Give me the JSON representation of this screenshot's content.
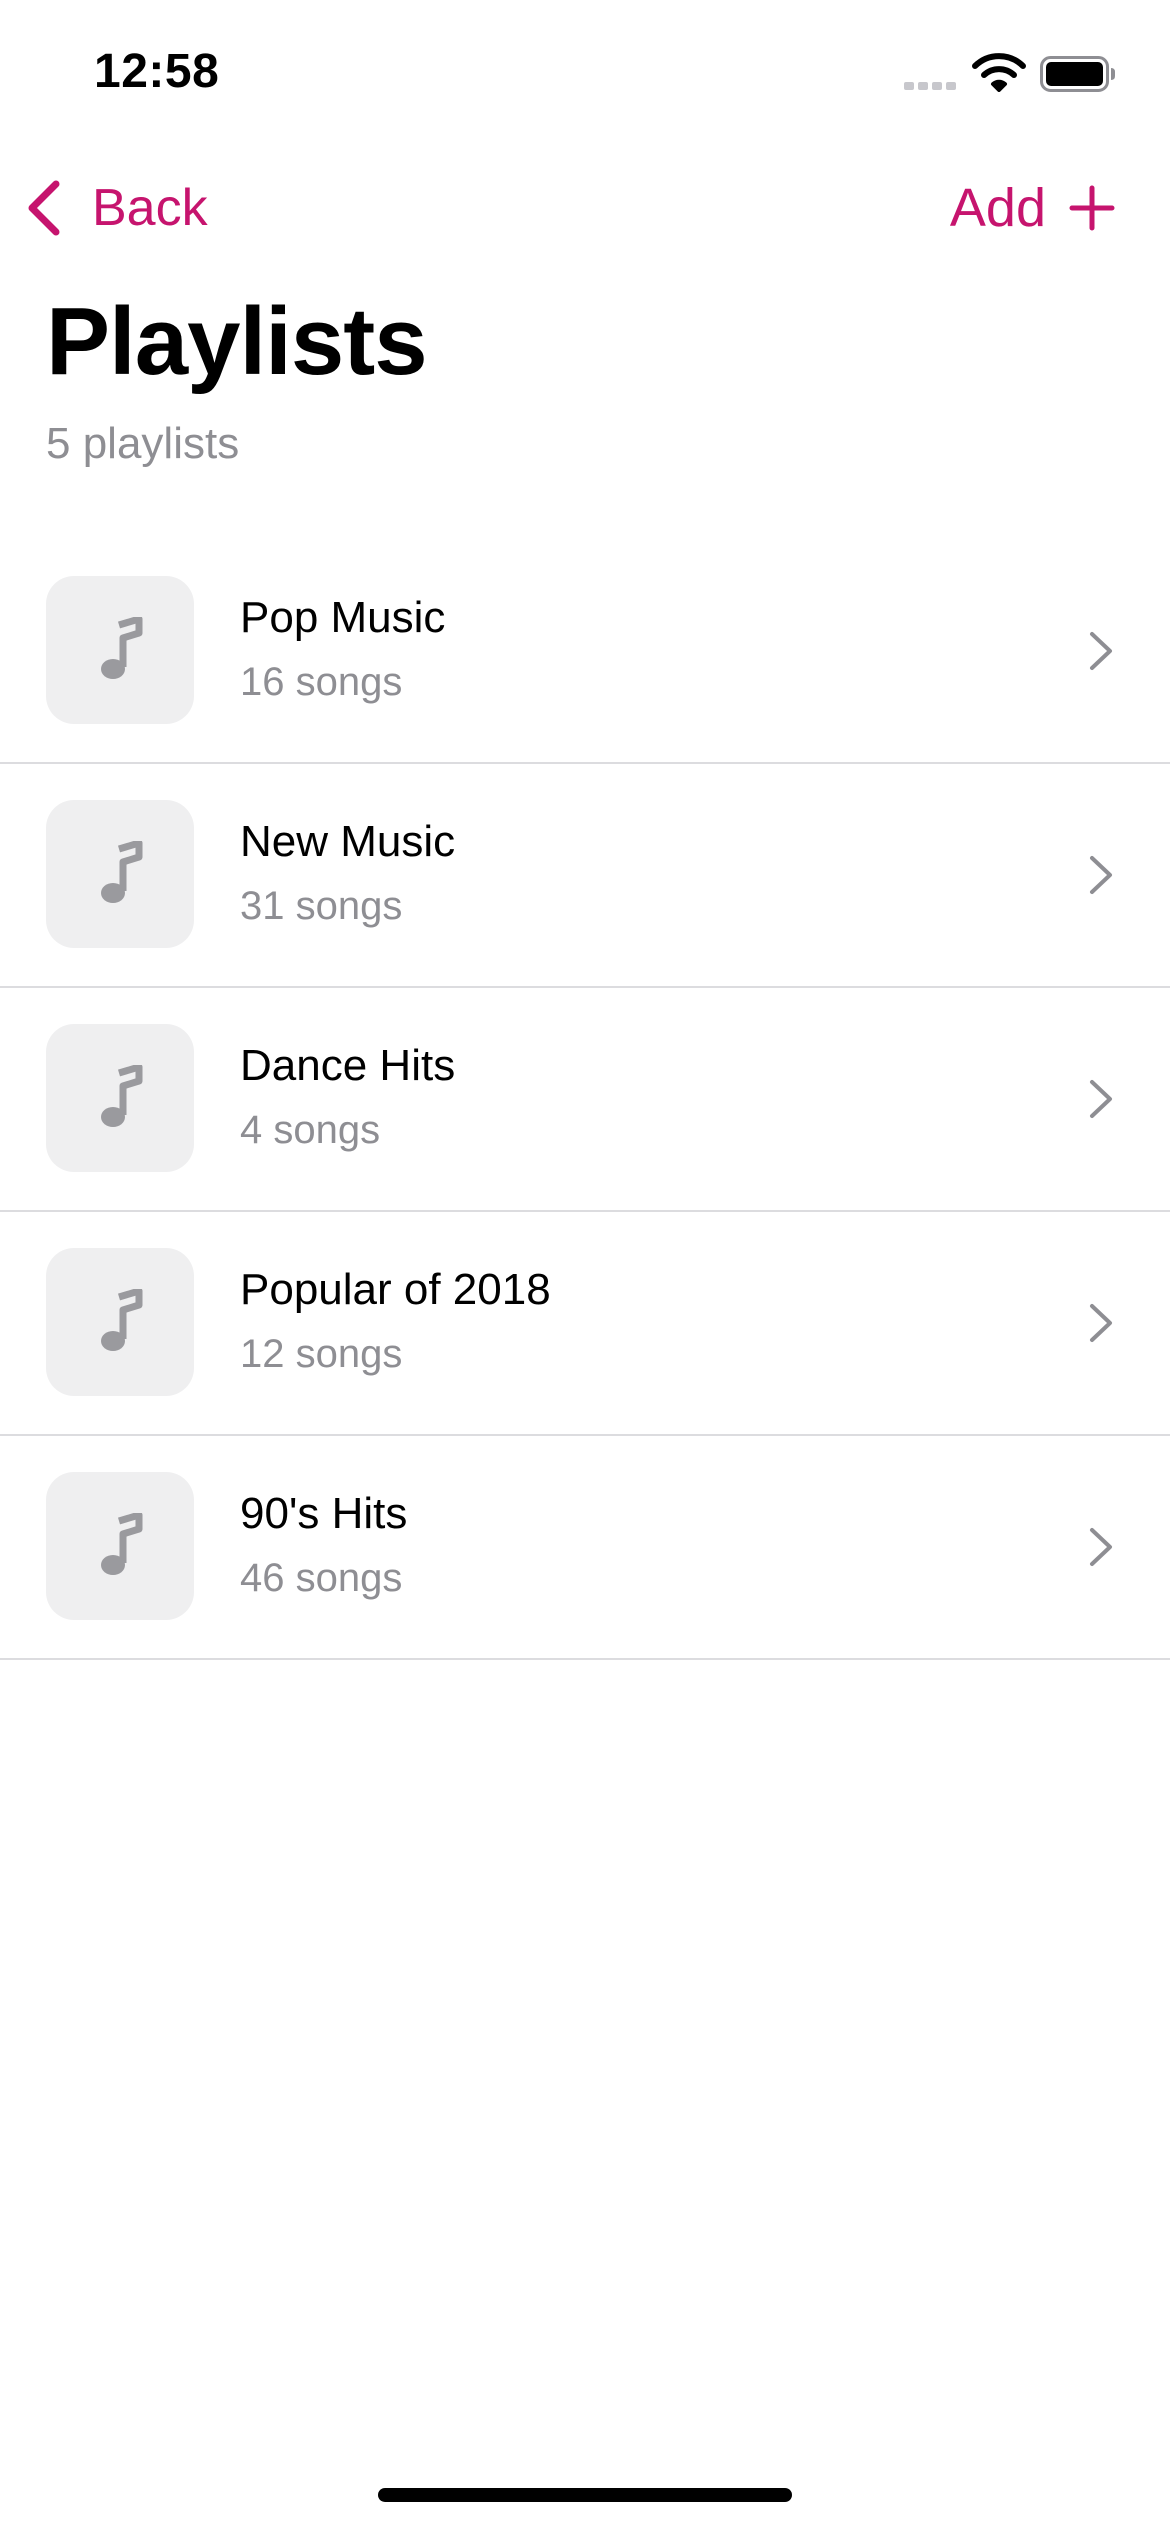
{
  "status_bar": {
    "time": "12:58"
  },
  "nav": {
    "back_label": "Back",
    "add_label": "Add"
  },
  "header": {
    "title": "Playlists",
    "subtitle": "5 playlists"
  },
  "playlists": [
    {
      "name": "Pop Music",
      "count": "16 songs"
    },
    {
      "name": "New Music",
      "count": "31 songs"
    },
    {
      "name": "Dance Hits",
      "count": "4 songs"
    },
    {
      "name": "Popular of 2018",
      "count": "12 songs"
    },
    {
      "name": "90's Hits",
      "count": "46 songs"
    }
  ],
  "colors": {
    "accent": "#c6146e",
    "secondary_text": "#8e8e93",
    "separator": "#dcdcdf",
    "artwork_bg": "#efeff0"
  },
  "icons": {
    "back": "chevron-left-icon",
    "add": "plus-icon",
    "artwork": "music-note-icon",
    "disclosure": "chevron-right-icon"
  }
}
